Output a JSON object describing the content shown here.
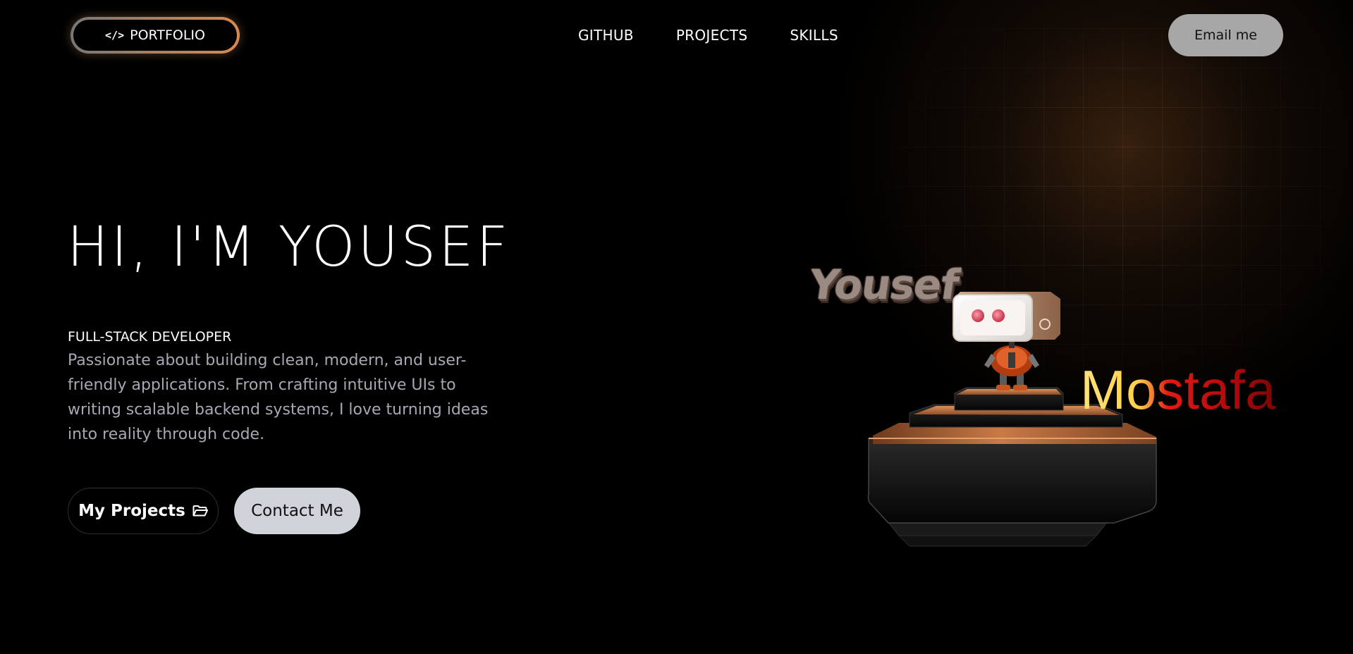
{
  "header": {
    "logo_icon": "</>",
    "logo_label": "PORTFOLIO",
    "nav": [
      {
        "label": "GITHUB"
      },
      {
        "label": "PROJECTS"
      },
      {
        "label": "SKILLS"
      }
    ],
    "email_label": "Email me"
  },
  "hero": {
    "title": "HI, I'M YOUSEF",
    "role": "FULL-STACK DEVELOPER",
    "description": "Passionate about building clean, modern, and user-friendly applications. From crafting intuitive UIs to writing scalable backend systems, I love turning ideas into reality through code.",
    "projects_button": "My Projects",
    "projects_icon": "folder-icon",
    "contact_button": "Contact Me"
  },
  "scene": {
    "name_left": "Yousef",
    "name_right": "Mostafa"
  },
  "colors": {
    "background": "#000000",
    "accent_orange": "#d98a4e",
    "email_button_bg": "#a7a7a7",
    "contact_button_bg": "#d0d3da",
    "muted_text": "#a6a9b3"
  }
}
